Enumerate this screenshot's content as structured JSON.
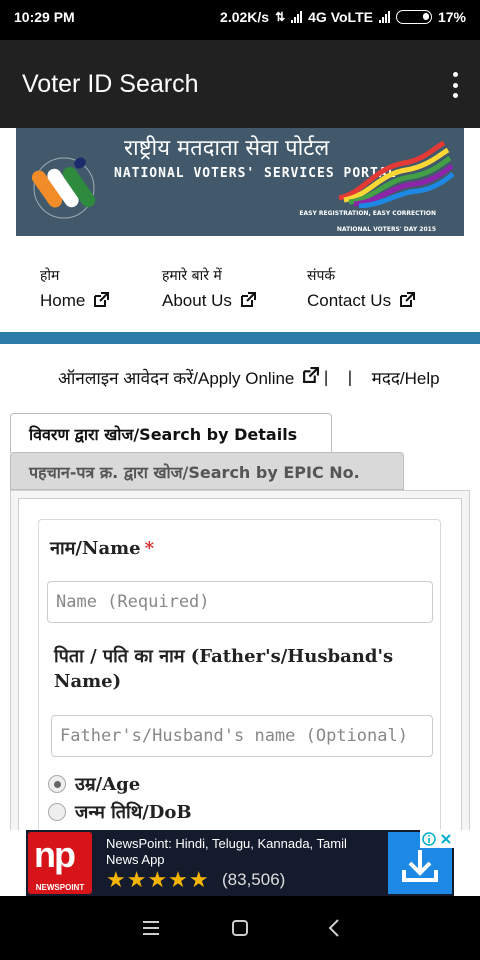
{
  "status_bar": {
    "time": "10:29 PM",
    "speed": "2.02K/s",
    "network": "4G VoLTE",
    "battery": "17%"
  },
  "app_bar": {
    "title": "Voter ID Search",
    "menu_icon": "more-vert-icon"
  },
  "banner": {
    "title_hindi": "राष्ट्रीय मतदाता सेवा पोर्टल",
    "title_english": "NATIONAL VOTERS' SERVICES PORTAL",
    "tagline": "EASY REGISTRATION, EASY CORRECTION",
    "event": "NATIONAL VOTERS' DAY 2015"
  },
  "nav": [
    {
      "hindi": "होम",
      "english": "Home"
    },
    {
      "hindi": "हमारे बारे में",
      "english": "About Us"
    },
    {
      "hindi": "संपर्क",
      "english": "Contact Us"
    }
  ],
  "apply_row": {
    "apply_label": "ऑनलाइन आवेदन करें/Apply Online",
    "sep1": "|",
    "sep2": "|",
    "help_label": "मदद/Help"
  },
  "tabs": [
    {
      "label": "विवरण द्वारा खोज/Search by Details",
      "active": true
    },
    {
      "label": "पहचान-पत्र क्र. द्वारा खोज/Search by EPIC No.",
      "active": false
    }
  ],
  "form": {
    "name_label": "नाम/Name",
    "required_mark": "*",
    "name_placeholder": "Name (Required)",
    "relative_label_line1": "पिता / पति का नाम (Father's/Husband's",
    "relative_label_line2": "Name)",
    "relative_placeholder": "Father's/Husband's name (Optional)",
    "age_option": "उम्र/Age",
    "dob_option": "जन्म तिथि/DoB",
    "selected_option": "age"
  },
  "ad": {
    "logo_text": "np",
    "logo_caption": "NEWSPOINT",
    "title": "NewsPoint: Hindi, Telugu, Kannada, Tamil News App",
    "stars": "★★★★★",
    "rating": 4.5,
    "rating_count": "(83,506)"
  },
  "colors": {
    "app_bar": "#212121",
    "accent_rule": "#2a7ba8",
    "banner_bg": "#41596b",
    "required": "#d32f2f",
    "ad_bg": "#141b2d",
    "ad_logo": "#d7141a",
    "ad_install": "#1e88e5"
  }
}
